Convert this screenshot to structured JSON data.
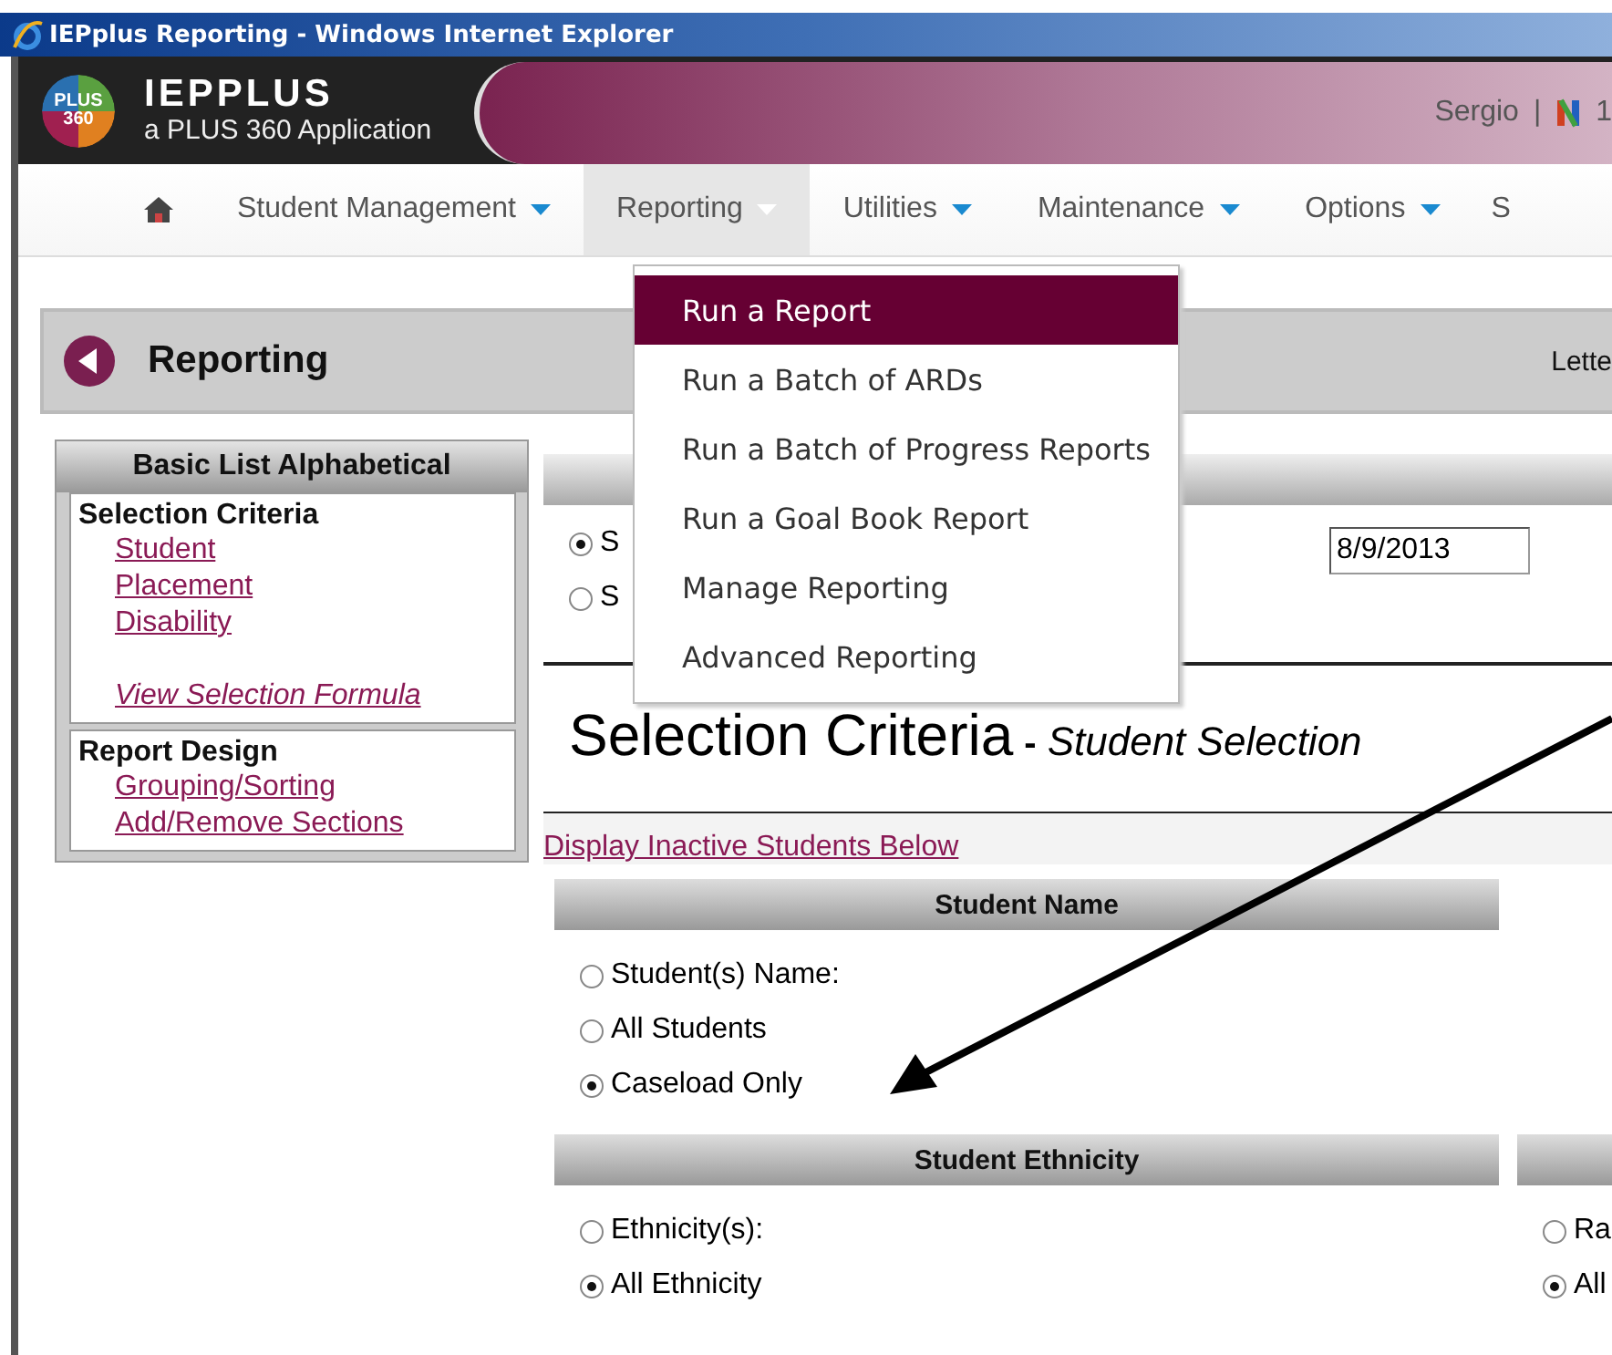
{
  "window": {
    "title": "IEPplus Reporting - Windows Internet Explorer"
  },
  "header": {
    "product": "IEPPLUS",
    "tagline": "a PLUS 360 Application",
    "logo_text": [
      "PLUS",
      "360"
    ],
    "user": "Sergio",
    "separator": "|",
    "account": "1"
  },
  "nav": {
    "items": [
      {
        "label": "Student Management",
        "selected": false
      },
      {
        "label": "Reporting",
        "selected": true
      },
      {
        "label": "Utilities",
        "selected": false
      },
      {
        "label": "Maintenance",
        "selected": false
      },
      {
        "label": "Options",
        "selected": false
      }
    ],
    "cut_item": "S"
  },
  "menu": {
    "items": [
      {
        "label": "Run a Report",
        "selected": true
      },
      {
        "label": "Run a Batch of ARDs",
        "selected": false
      },
      {
        "label": "Run a Batch of Progress Reports",
        "selected": false
      },
      {
        "label": "Run a Goal Book Report",
        "selected": false
      },
      {
        "label": "Manage Reporting",
        "selected": false
      },
      {
        "label": "Advanced Reporting",
        "selected": false
      }
    ]
  },
  "page_header": {
    "title": "Reporting",
    "right_text": "Lette"
  },
  "sidebar": {
    "title": "Basic List Alphabetical",
    "sections": [
      {
        "heading": "Selection Criteria",
        "links": [
          {
            "label": "Student",
            "kind": "plain"
          },
          {
            "label": "Placement",
            "kind": "plain"
          },
          {
            "label": "Disability",
            "kind": "plain"
          },
          {
            "label": "View Selection Formula",
            "kind": "formula"
          }
        ]
      },
      {
        "heading": "Report Design",
        "links": [
          {
            "label": "Grouping/Sorting",
            "kind": "plain"
          },
          {
            "label": "Add/Remove Sections",
            "kind": "plain"
          }
        ]
      }
    ]
  },
  "options": {
    "radios": [
      {
        "label": "S",
        "selected": true
      },
      {
        "label": "S",
        "selected": false
      }
    ],
    "date": "8/9/2013"
  },
  "criteria": {
    "title": "Selection Criteria",
    "separator": "-",
    "subtitle": "Student Selection",
    "inactive_link": "Display Inactive Students Below",
    "groups": [
      {
        "title": "Student Name",
        "options": [
          {
            "label": "Student(s) Name:",
            "selected": false
          },
          {
            "label": "All Students",
            "selected": false
          },
          {
            "label": "Caseload Only",
            "selected": true
          }
        ]
      },
      {
        "title": "Student Ethnicity",
        "options": [
          {
            "label": "Ethnicity(s):",
            "selected": false
          },
          {
            "label": "All Ethnicity",
            "selected": true
          }
        ]
      }
    ],
    "side_options": [
      {
        "label": "Ra",
        "selected": false
      },
      {
        "label": "All",
        "selected": true
      }
    ]
  }
}
